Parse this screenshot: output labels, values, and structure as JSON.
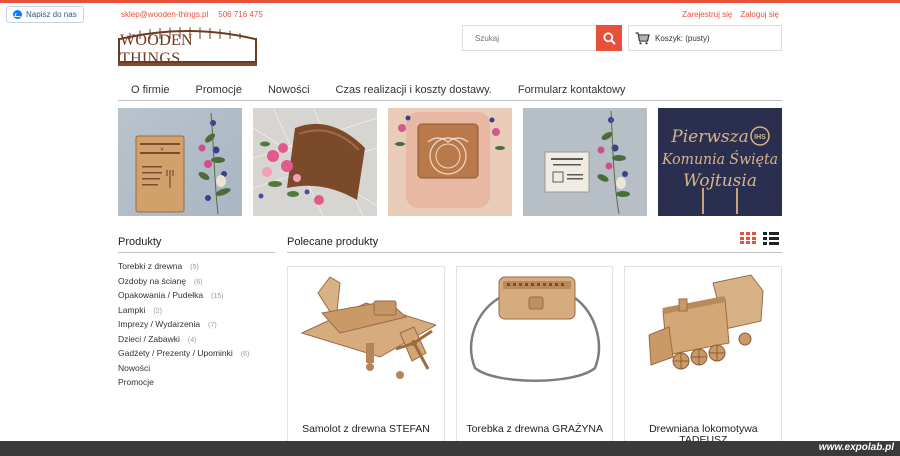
{
  "messenger": {
    "label": "Napisz do nas",
    "icon": "messenger-icon"
  },
  "contact": {
    "email": "sklep@wooden-things.pl",
    "phone": "506 716 475"
  },
  "auth": {
    "register": "Zarejestruj się",
    "login": "Zaloguj się"
  },
  "logo": {
    "text": "WOODEN THINGS"
  },
  "search": {
    "placeholder": "Szukaj",
    "icon": "search-icon"
  },
  "cart": {
    "label": "Koszyk: (pusty)",
    "icon": "cart-icon"
  },
  "nav": [
    "O firmie",
    "Promocje",
    "Nowości",
    "Czas realizacji i koszty dostawy.",
    "Formularz kontaktowy"
  ],
  "banners": [
    {
      "name": "banner-wooden-board"
    },
    {
      "name": "banner-wooden-box-flowers"
    },
    {
      "name": "banner-pillow-box"
    },
    {
      "name": "banner-cake-topper-box"
    },
    {
      "name": "banner-communion-topper",
      "text_line1": "Pierwsza",
      "text_line2": "Komunia Święta",
      "text_line3": "Wojtusia",
      "badge": "IHS"
    }
  ],
  "sidebar": {
    "title": "Produkty",
    "categories": [
      {
        "label": "Torebki z drewna",
        "count": "(5)"
      },
      {
        "label": "Ozdoby na ścianę",
        "count": "(6)"
      },
      {
        "label": "Opakowania / Pudełka",
        "count": "(15)"
      },
      {
        "label": "Lampki",
        "count": "(2)"
      },
      {
        "label": "Imprezy / Wydarzenia",
        "count": "(7)"
      },
      {
        "label": "Dzieci / Zabawki",
        "count": "(4)"
      },
      {
        "label": "Gadżety / Prezenty / Upominki",
        "count": "(6)"
      },
      {
        "label": "Nowości",
        "count": ""
      },
      {
        "label": "Promocje",
        "count": ""
      }
    ]
  },
  "featured": {
    "title": "Polecane produkty",
    "products": [
      {
        "name": "Samolot z drewna STEFAN"
      },
      {
        "name": "Torebka z drewna GRAŻYNA"
      },
      {
        "name": "Drewniana lokomotywa TADEUSZ"
      }
    ]
  },
  "watermark": "www.expolab.pl",
  "colors": {
    "accent": "#e8503a",
    "wood": "#c89a6a",
    "brand": "#6d3a22"
  }
}
